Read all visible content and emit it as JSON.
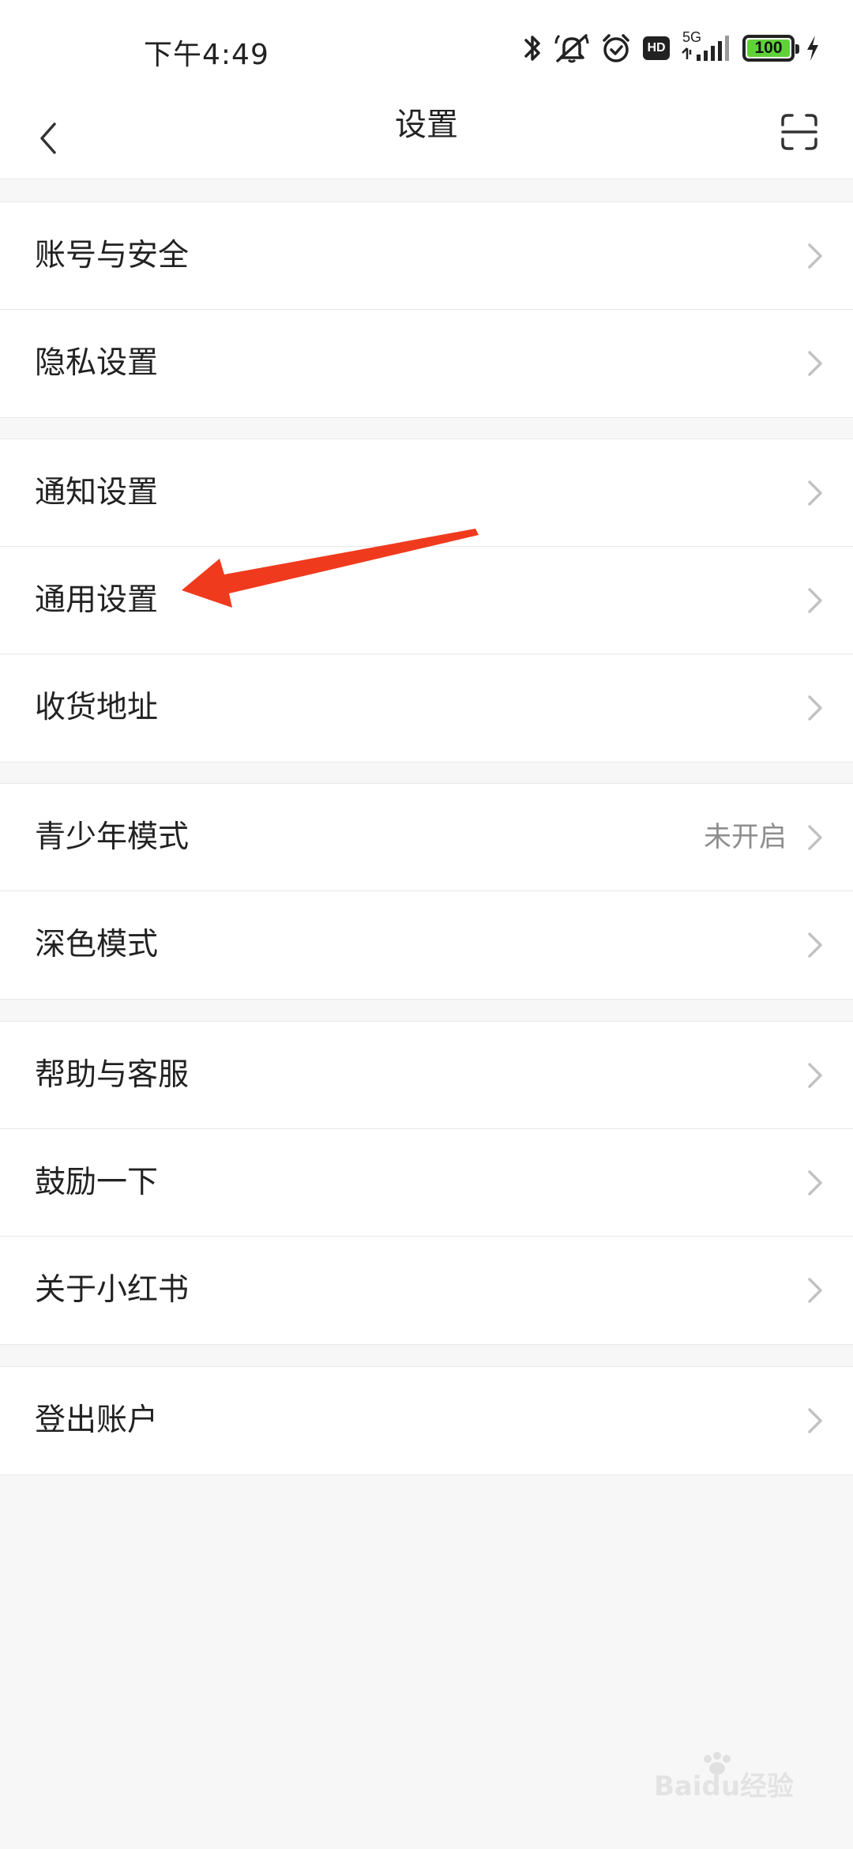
{
  "status_bar": {
    "time": "下午4:49",
    "network": "5G",
    "hd": "HD",
    "battery": "100",
    "battery_color": "#5fd23a"
  },
  "header": {
    "title": "设置"
  },
  "sections": [
    {
      "items": [
        {
          "label": "账号与安全"
        },
        {
          "label": "隐私设置"
        }
      ]
    },
    {
      "items": [
        {
          "label": "通知设置"
        },
        {
          "label": "通用设置"
        },
        {
          "label": "收货地址"
        }
      ]
    },
    {
      "items": [
        {
          "label": "青少年模式",
          "value": "未开启"
        },
        {
          "label": "深色模式"
        }
      ]
    },
    {
      "items": [
        {
          "label": "帮助与客服"
        },
        {
          "label": "鼓励一下"
        },
        {
          "label": "关于小红书"
        }
      ]
    },
    {
      "items": [
        {
          "label": "登出账户"
        }
      ]
    }
  ],
  "annotation_arrow_color": "#f03a1e",
  "watermark": "Baidu经验",
  "icons": [
    "back-icon",
    "scan-icon",
    "chevron-right-icon",
    "bluetooth-icon",
    "mute-icon",
    "alarm-icon",
    "signal-icon",
    "charging-icon"
  ]
}
